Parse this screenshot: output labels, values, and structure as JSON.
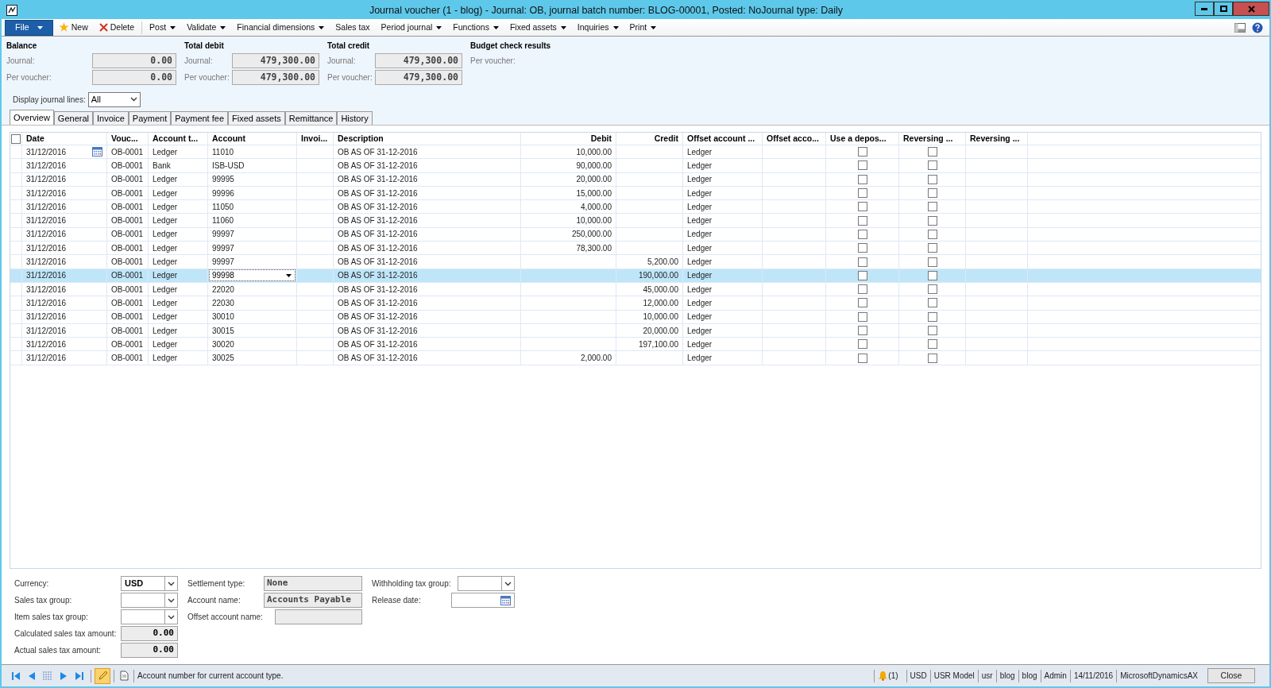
{
  "window": {
    "title": "Journal voucher (1 - blog) - Journal: OB, journal batch number: BLOG-00001, Posted: NoJournal type: Daily"
  },
  "toolbar": [
    {
      "label": "File",
      "kind": "file",
      "dropdown": true
    },
    {
      "label": "New",
      "kind": "new",
      "dropdown": false
    },
    {
      "label": "Delete",
      "kind": "delete",
      "dropdown": false
    },
    {
      "label": "Post",
      "kind": "menu",
      "dropdown": true
    },
    {
      "label": "Validate",
      "kind": "menu",
      "dropdown": true
    },
    {
      "label": "Financial dimensions",
      "kind": "menu",
      "dropdown": true
    },
    {
      "label": "Sales tax",
      "kind": "menu",
      "dropdown": false
    },
    {
      "label": "Period journal",
      "kind": "menu",
      "dropdown": true
    },
    {
      "label": "Functions",
      "kind": "menu",
      "dropdown": true
    },
    {
      "label": "Fixed assets",
      "kind": "menu",
      "dropdown": true
    },
    {
      "label": "Inquiries",
      "kind": "menu",
      "dropdown": true
    },
    {
      "label": "Print",
      "kind": "menu",
      "dropdown": true
    }
  ],
  "totals": [
    {
      "title": "Balance",
      "fields": [
        {
          "label": "Journal:",
          "value": "0.00"
        },
        {
          "label": "Per voucher:",
          "value": "0.00"
        }
      ]
    },
    {
      "title": "Total debit",
      "fields": [
        {
          "label": "Journal:",
          "value": "479,300.00"
        },
        {
          "label": "Per voucher:",
          "value": "479,300.00"
        }
      ]
    },
    {
      "title": "Total credit",
      "fields": [
        {
          "label": "Journal:",
          "value": "479,300.00"
        },
        {
          "label": "Per voucher:",
          "value": "479,300.00"
        }
      ]
    },
    {
      "title": "Budget check results",
      "fields": [
        {
          "label": "Per voucher:"
        }
      ]
    }
  ],
  "display_filter": {
    "label": "Display journal lines:",
    "value": "All"
  },
  "tabs": [
    {
      "label": "Overview",
      "selected": true
    },
    {
      "label": "General",
      "selected": false
    },
    {
      "label": "Invoice",
      "selected": false
    },
    {
      "label": "Payment",
      "selected": false
    },
    {
      "label": "Payment fee",
      "selected": false
    },
    {
      "label": "Fixed assets",
      "selected": false
    },
    {
      "label": "Remittance",
      "selected": false
    },
    {
      "label": "History",
      "selected": false
    }
  ],
  "table": {
    "select_all": false,
    "columns": [
      "Date",
      "Vouc...",
      "Account t...",
      "Account",
      "Invoi...",
      "Description",
      "Debit",
      "Credit",
      "Offset account ...",
      "Offset acco...",
      "Use a depos...",
      "Reversing ...",
      "Reversing ..."
    ],
    "rows": [
      {
        "date": "31/12/2016",
        "voucher": "OB-0001",
        "account_type": "Ledger",
        "account": "11010",
        "description": "OB AS OF 31-12-2016",
        "debit": "10,000.00",
        "offset_account_type": "Ledger",
        "use_deposit": false,
        "reversing": false,
        "date_picker": true,
        "selected": false
      },
      {
        "date": "31/12/2016",
        "voucher": "OB-0001",
        "account_type": "Bank",
        "account": "ISB-USD",
        "description": "OB AS OF 31-12-2016",
        "debit": "90,000.00",
        "offset_account_type": "Ledger",
        "use_deposit": false,
        "reversing": false,
        "date_picker": false,
        "selected": false
      },
      {
        "date": "31/12/2016",
        "voucher": "OB-0001",
        "account_type": "Ledger",
        "account": "99995",
        "description": "OB AS OF 31-12-2016",
        "debit": "20,000.00",
        "offset_account_type": "Ledger",
        "use_deposit": false,
        "reversing": false,
        "date_picker": false,
        "selected": false
      },
      {
        "date": "31/12/2016",
        "voucher": "OB-0001",
        "account_type": "Ledger",
        "account": "99996",
        "description": "OB AS OF 31-12-2016",
        "debit": "15,000.00",
        "offset_account_type": "Ledger",
        "use_deposit": false,
        "reversing": false,
        "date_picker": false,
        "selected": false
      },
      {
        "date": "31/12/2016",
        "voucher": "OB-0001",
        "account_type": "Ledger",
        "account": "11050",
        "description": "OB AS OF 31-12-2016",
        "debit": "4,000.00",
        "offset_account_type": "Ledger",
        "use_deposit": false,
        "reversing": false,
        "date_picker": false,
        "selected": false
      },
      {
        "date": "31/12/2016",
        "voucher": "OB-0001",
        "account_type": "Ledger",
        "account": "11060",
        "description": "OB AS OF 31-12-2016",
        "debit": "10,000.00",
        "offset_account_type": "Ledger",
        "use_deposit": false,
        "reversing": false,
        "date_picker": false,
        "selected": false
      },
      {
        "date": "31/12/2016",
        "voucher": "OB-0001",
        "account_type": "Ledger",
        "account": "99997",
        "description": "OB AS OF 31-12-2016",
        "debit": "250,000.00",
        "offset_account_type": "Ledger",
        "use_deposit": false,
        "reversing": false,
        "date_picker": false,
        "selected": false
      },
      {
        "date": "31/12/2016",
        "voucher": "OB-0001",
        "account_type": "Ledger",
        "account": "99997",
        "description": "OB AS OF 31-12-2016",
        "debit": "78,300.00",
        "offset_account_type": "Ledger",
        "use_deposit": false,
        "reversing": false,
        "date_picker": false,
        "selected": false
      },
      {
        "date": "31/12/2016",
        "voucher": "OB-0001",
        "account_type": "Ledger",
        "account": "99997",
        "description": "OB AS OF 31-12-2016",
        "credit": "5,200.00",
        "offset_account_type": "Ledger",
        "use_deposit": false,
        "reversing": false,
        "date_picker": false,
        "selected": false
      },
      {
        "date": "31/12/2016",
        "voucher": "OB-0001",
        "account_type": "Ledger",
        "account": "99998",
        "description": "OB AS OF 31-12-2016",
        "credit": "190,000.00",
        "offset_account_type": "Ledger",
        "use_deposit": false,
        "reversing": false,
        "date_picker": false,
        "selected": true
      },
      {
        "date": "31/12/2016",
        "voucher": "OB-0001",
        "account_type": "Ledger",
        "account": "22020",
        "description": "OB AS OF 31-12-2016",
        "credit": "45,000.00",
        "offset_account_type": "Ledger",
        "use_deposit": false,
        "reversing": false,
        "date_picker": false,
        "selected": false
      },
      {
        "date": "31/12/2016",
        "voucher": "OB-0001",
        "account_type": "Ledger",
        "account": "22030",
        "description": "OB AS OF 31-12-2016",
        "credit": "12,000.00",
        "offset_account_type": "Ledger",
        "use_deposit": false,
        "reversing": false,
        "date_picker": false,
        "selected": false
      },
      {
        "date": "31/12/2016",
        "voucher": "OB-0001",
        "account_type": "Ledger",
        "account": "30010",
        "description": "OB AS OF 31-12-2016",
        "credit": "10,000.00",
        "offset_account_type": "Ledger",
        "use_deposit": false,
        "reversing": false,
        "date_picker": false,
        "selected": false
      },
      {
        "date": "31/12/2016",
        "voucher": "OB-0001",
        "account_type": "Ledger",
        "account": "30015",
        "description": "OB AS OF 31-12-2016",
        "credit": "20,000.00",
        "offset_account_type": "Ledger",
        "use_deposit": false,
        "reversing": false,
        "date_picker": false,
        "selected": false
      },
      {
        "date": "31/12/2016",
        "voucher": "OB-0001",
        "account_type": "Ledger",
        "account": "30020",
        "description": "OB AS OF 31-12-2016",
        "credit": "197,100.00",
        "offset_account_type": "Ledger",
        "use_deposit": false,
        "reversing": false,
        "date_picker": false,
        "selected": false
      },
      {
        "date": "31/12/2016",
        "voucher": "OB-0001",
        "account_type": "Ledger",
        "account": "30025",
        "description": "OB AS OF 31-12-2016",
        "debit": "2,000.00",
        "offset_account_type": "Ledger",
        "use_deposit": false,
        "reversing": false,
        "date_picker": false,
        "selected": false
      }
    ]
  },
  "details": [
    [
      {
        "label": "Currency:",
        "kind": "combo",
        "value": "USD"
      },
      {
        "label": "Sales tax group:",
        "kind": "combo"
      },
      {
        "label": "Item sales tax group:",
        "kind": "combo"
      },
      {
        "label": "Calculated sales tax amount:",
        "kind": "amount",
        "value": "0.00"
      },
      {
        "label": "Actual sales tax amount:",
        "kind": "amount",
        "value": "0.00"
      }
    ],
    [
      {
        "label": "Settlement type:",
        "kind": "readonly",
        "value": "None"
      },
      {
        "label": "Account name:",
        "kind": "readonly",
        "value": "Accounts Payable"
      },
      {
        "label": "Offset account name:",
        "kind": "readonly"
      }
    ],
    [
      {
        "label": "Withholding tax group:",
        "kind": "combo"
      },
      {
        "label": "Release date:",
        "kind": "date"
      }
    ]
  ],
  "status_bar": {
    "edit_mode": true,
    "help_text": "Account number for current account type.",
    "alerts": "(1)",
    "items": [
      "USD",
      "USR Model",
      "usr",
      "blog",
      "blog",
      "Admin",
      "14/11/2016",
      "MicrosoftDynamicsAX"
    ],
    "close": "Close"
  }
}
